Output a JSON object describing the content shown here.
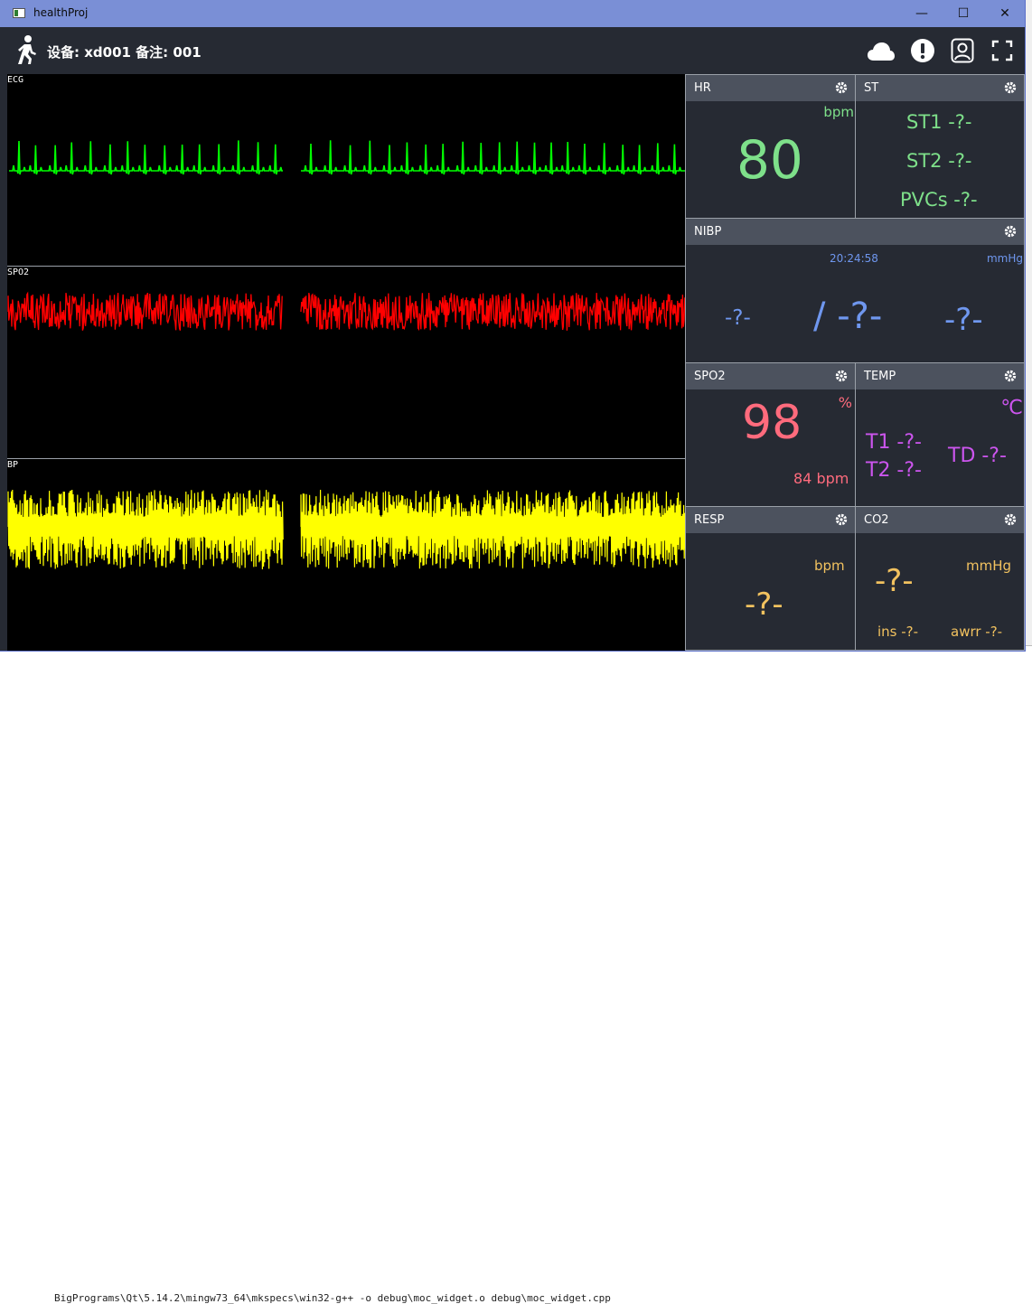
{
  "window": {
    "title": "healthProj",
    "min_symbol": "—",
    "max_symbol": "☐",
    "close_symbol": "✕"
  },
  "header": {
    "device_text": "设备: xd001 备注: 001",
    "icons": [
      "walking-person-icon",
      "cloud-icon",
      "alert-icon",
      "user-profile-icon",
      "fullscreen-icon"
    ]
  },
  "waves": [
    {
      "label": "ECG",
      "color": "#00ff00"
    },
    {
      "label": "SPO2",
      "color": "#ff0000"
    },
    {
      "label": "BP",
      "color": "#ffff00"
    }
  ],
  "hr": {
    "title": "HR",
    "unit": "bpm",
    "value": "80",
    "color": "#7ee08a"
  },
  "st": {
    "title": "ST",
    "st1": "ST1 -?-",
    "st2": "ST2 -?-",
    "pvcs": "PVCs -?-",
    "color": "#7ee08a"
  },
  "nibp": {
    "title": "NIBP",
    "time": "20:24:58",
    "unit": "mmHg",
    "left": "-?-",
    "middle": "/ -?-",
    "right": "-?-",
    "color": "#6f97ef"
  },
  "spo2": {
    "title": "SPO2",
    "unit": "%",
    "value": "98",
    "pulse": "84 bpm",
    "color": "#ff6b7d"
  },
  "temp": {
    "title": "TEMP",
    "unit": "℃",
    "t1": "T1 -?-",
    "t2": "T2 -?-",
    "td": "TD -?-",
    "color": "#cc55ee"
  },
  "resp": {
    "title": "RESP",
    "unit": "bpm",
    "value": "-?-",
    "color": "#f2c25f"
  },
  "co2": {
    "title": "CO2",
    "unit": "mmHg",
    "value": "-?-",
    "ins": "ins -?-",
    "awrr": "awrr -?-",
    "color": "#f2c25f"
  },
  "desktop": {
    "console_text": "BigPrograms\\Qt\\5.14.2\\mingw73_64\\mkspecs\\win32-g++  -o debug\\moc_widget.o debug\\moc_widget.cpp"
  }
}
